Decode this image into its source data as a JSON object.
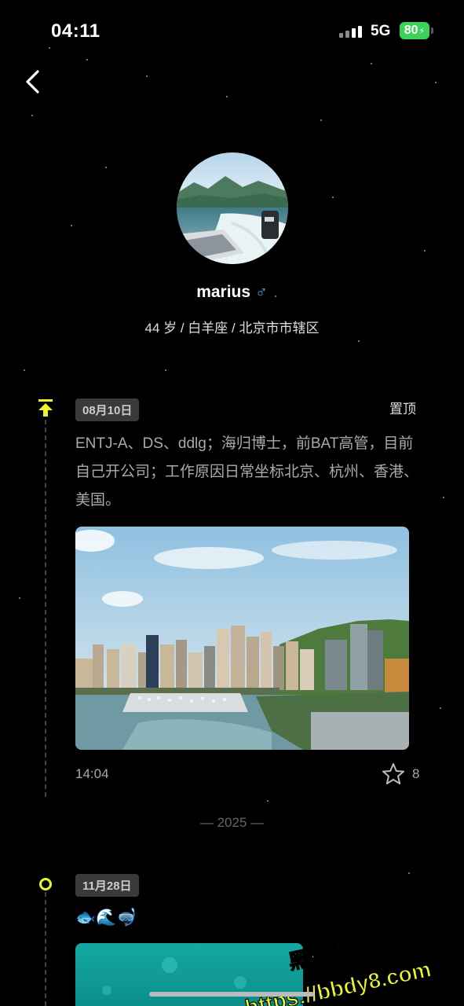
{
  "status_bar": {
    "time": "04:11",
    "network": "5G",
    "battery": "80"
  },
  "nav": {
    "back_icon": "chevron-left-icon"
  },
  "profile": {
    "name": "marius",
    "gender_symbol": "♂",
    "meta": "44 岁 / 白羊座 / 北京市市辖区"
  },
  "posts": [
    {
      "date": "08月10日",
      "pinned_label": "置顶",
      "text": "ENTJ-A、DS、ddlg；海归博士，前BAT高管，目前自己开公司；工作原因日常坐标北京、杭州、香港、美国。",
      "time": "14:04",
      "likes": "8"
    },
    {
      "date": "11月28日",
      "emojis": "🐟🌊🤿"
    }
  ],
  "year_divider": "— 2025 —",
  "watermark": {
    "line1": "黑料不打烊",
    "line2": "https://bbdy8.com"
  },
  "colors": {
    "accent": "#e8f62b",
    "male": "#4aa3ff",
    "battery": "#3bd15a"
  }
}
